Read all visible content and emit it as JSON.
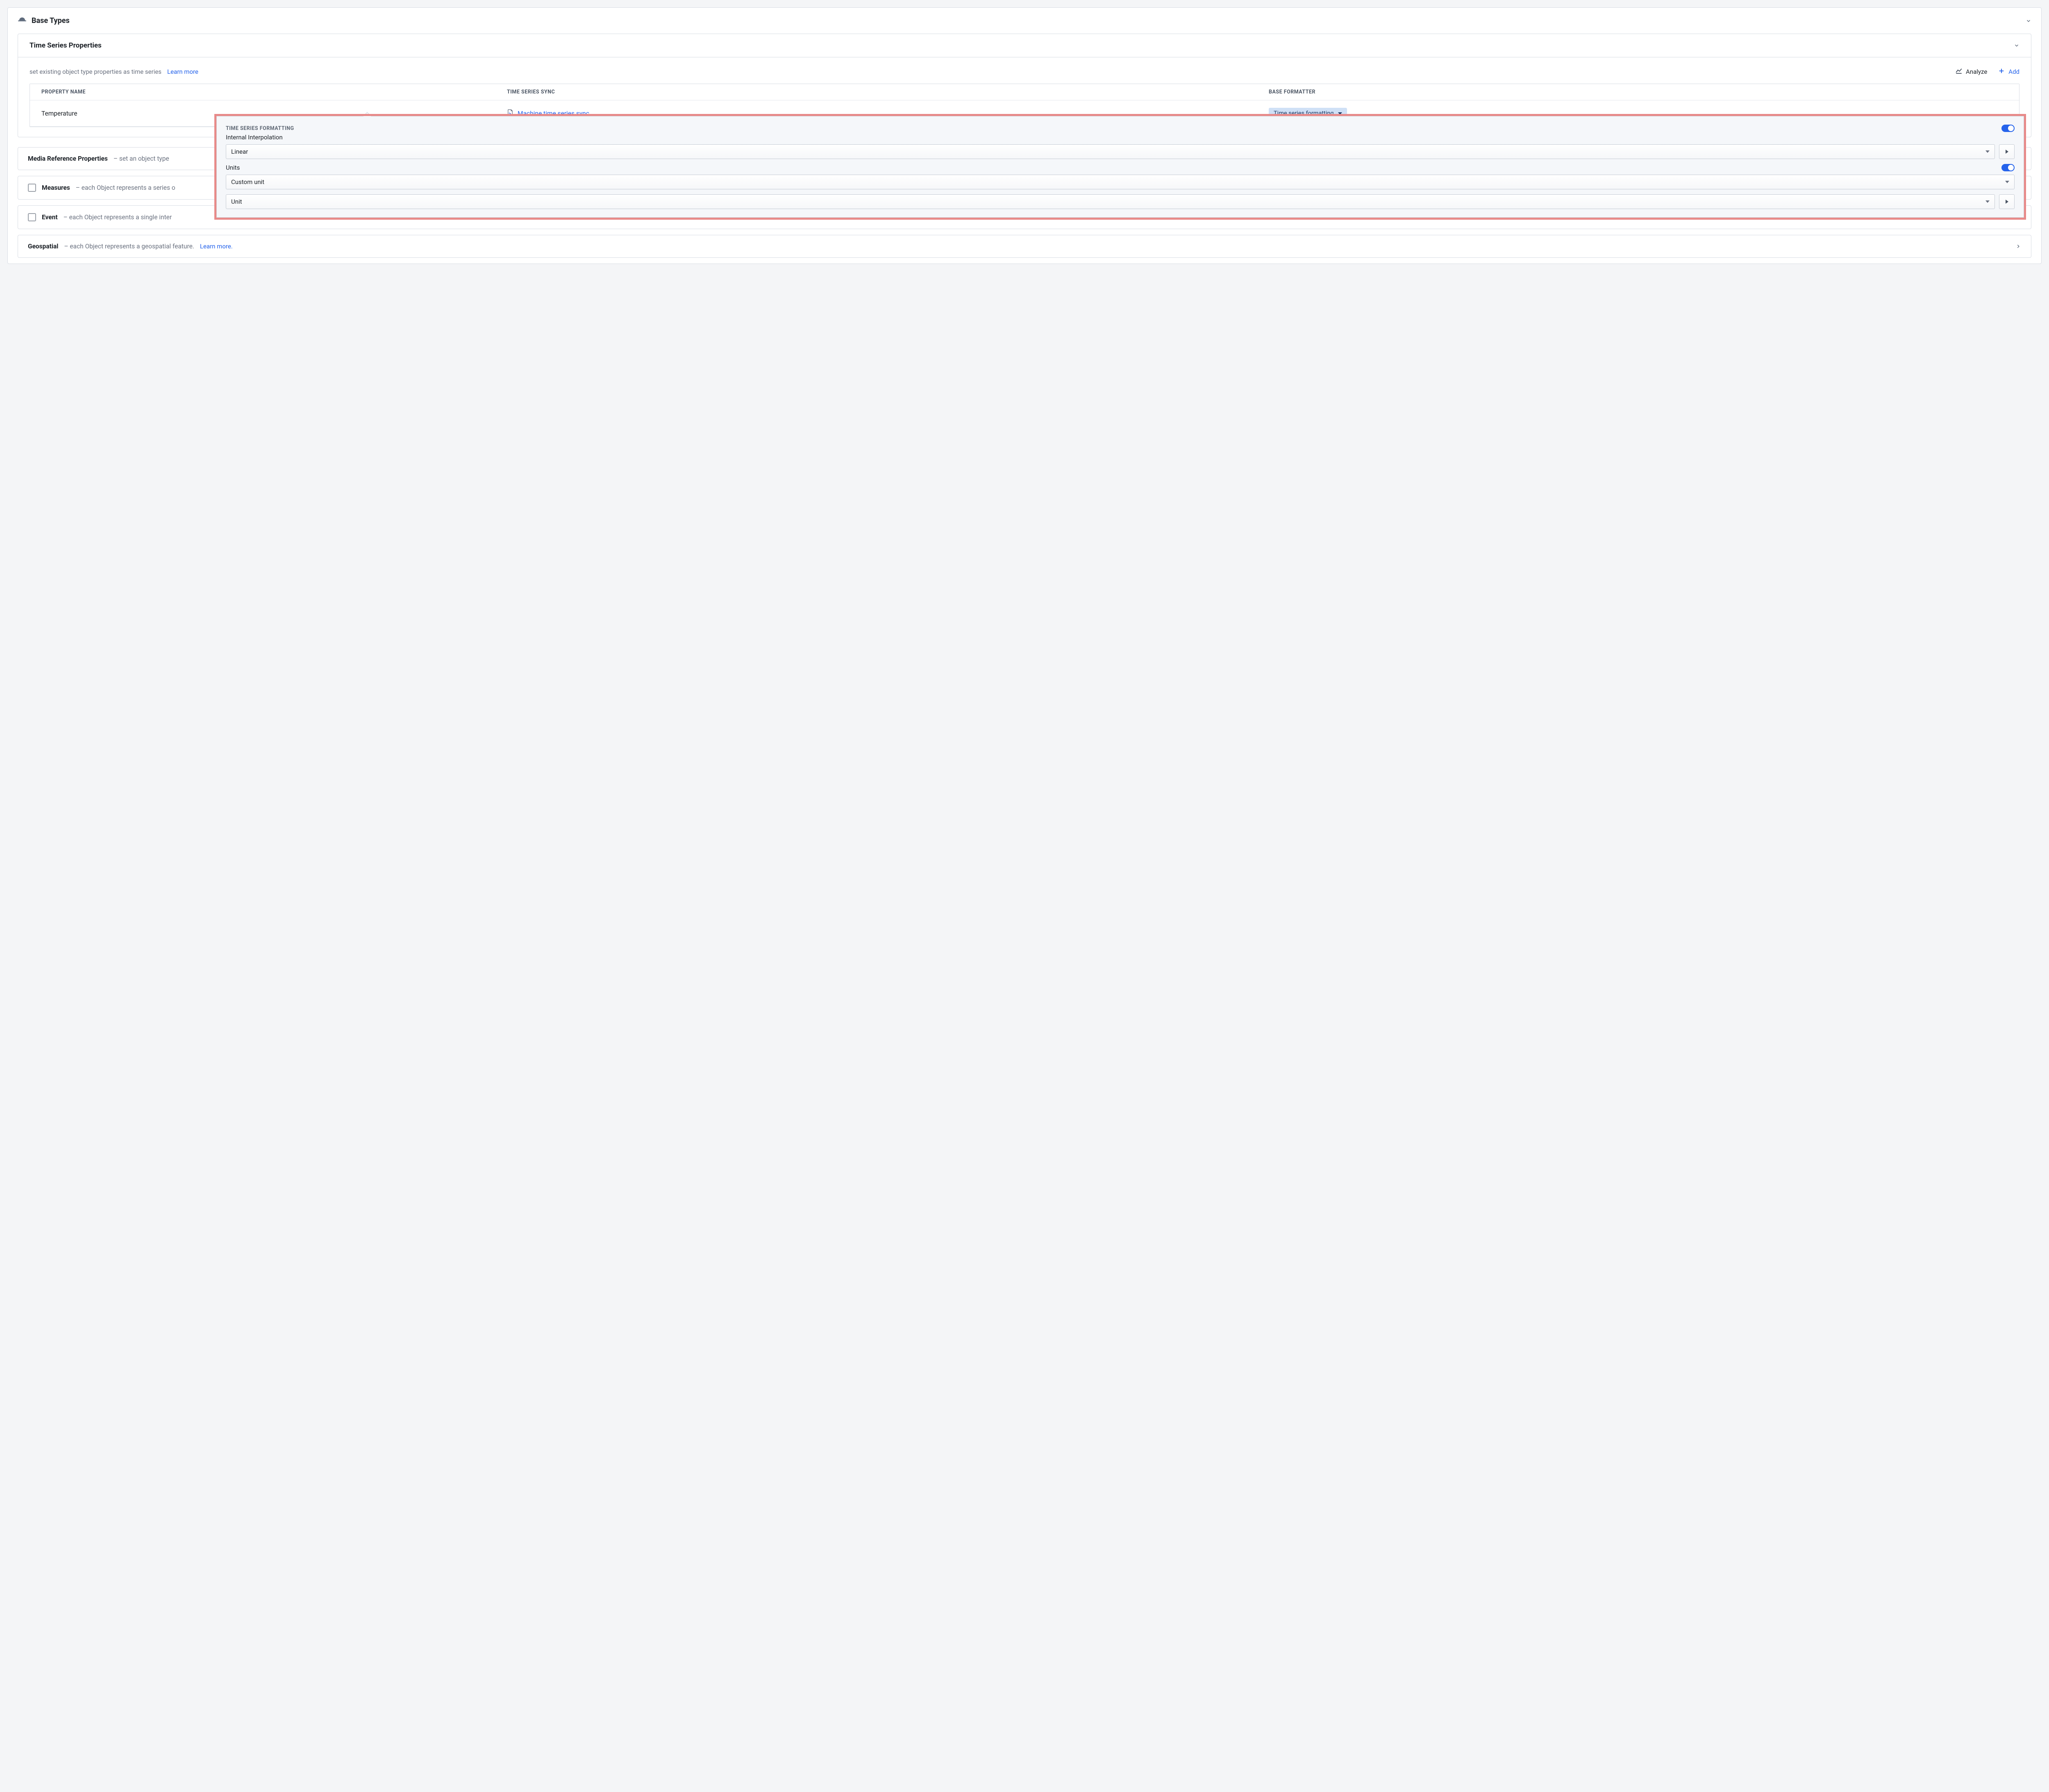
{
  "header": {
    "title": "Base Types"
  },
  "ts_section": {
    "title": "Time Series Properties",
    "hint": "set existing object type properties as time series",
    "learn_more": "Learn more",
    "analyze": "Analyze",
    "add": "Add",
    "columns": {
      "property_name": "PROPERTY NAME",
      "time_series_sync": "TIME SERIES SYNC",
      "base_formatter": "BASE FORMATTER"
    },
    "row": {
      "property_name": "Temperature",
      "sync_label": "Machine time series sync",
      "formatter_label": "Time series formatting"
    }
  },
  "popover": {
    "section_title": "TIME SERIES FORMATTING",
    "interpolation_label": "Internal Interpolation",
    "interpolation_value": "Linear",
    "units_label": "Units",
    "units_type_value": "Custom unit",
    "units_value": "Unit"
  },
  "rows": {
    "media": {
      "title": "Media Reference Properties",
      "desc": "– set an object type"
    },
    "measures": {
      "title": "Measures",
      "desc": "– each Object represents a series o"
    },
    "event": {
      "title": "Event",
      "desc": "– each Object represents a single inter"
    },
    "geospatial": {
      "title": "Geospatial",
      "desc": "– each Object represents a geospatial feature.",
      "learn_more": "Learn more."
    }
  }
}
